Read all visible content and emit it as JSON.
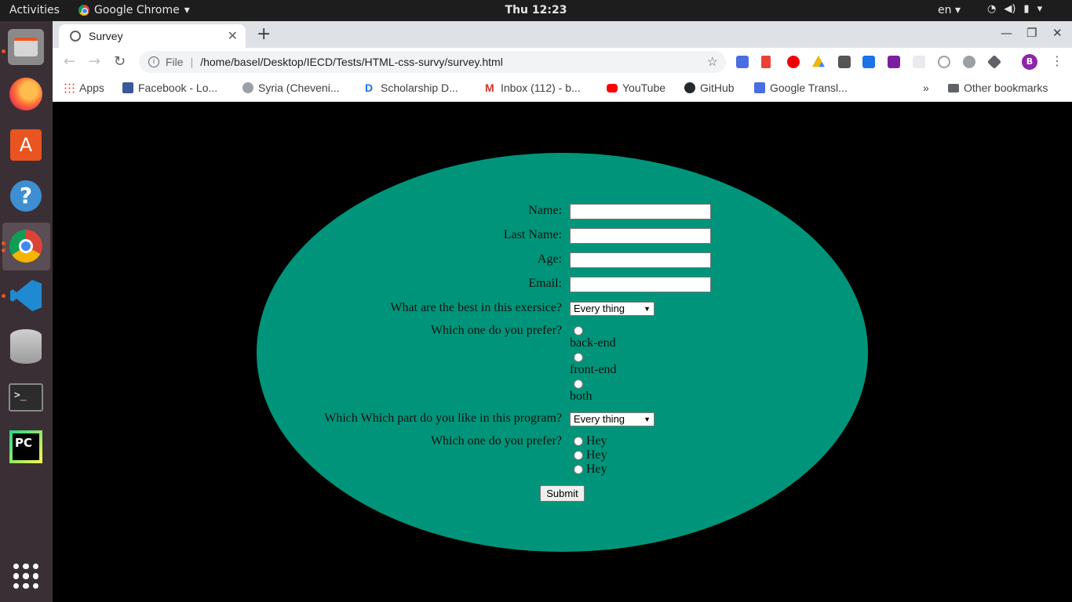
{
  "topbar": {
    "activities": "Activities",
    "app_name": "Google Chrome",
    "clock": "Thu 12:23",
    "lang": "en"
  },
  "tab": {
    "title": "Survey"
  },
  "omnibox": {
    "scheme_label": "File",
    "url": "/home/basel/Desktop/IECD/Tests/HTML-css-survy/survey.html"
  },
  "profile": {
    "initial": "B"
  },
  "bookmarks": {
    "items": [
      "Apps",
      "Facebook - Lo...",
      "Syria (Cheveni...",
      "Scholarship D...",
      "Inbox (112) - b...",
      "YouTube",
      "GitHub",
      "Google Transl..."
    ],
    "overflow": "»",
    "other": "Other bookmarks"
  },
  "form": {
    "name_label": "Name:",
    "lastname_label": "Last Name:",
    "age_label": "Age:",
    "email_label": "Email:",
    "q1_label": "What are the best in this exersice?",
    "q1_selected": "Every thing",
    "q2_label": "Which one do you prefer?",
    "q2_options": [
      "back-end",
      "front-end",
      "both"
    ],
    "q3_label": "Which Which part do you like in this program?",
    "q3_selected": "Every thing",
    "q4_label": "Which one do you prefer?",
    "q4_options": [
      "Hey",
      "Hey",
      "Hey"
    ],
    "submit_label": "Submit"
  },
  "colors": {
    "ellipse": "#00957a",
    "page_bg": "#000000",
    "dock_bg": "#3b2f36",
    "accent": "#e95420"
  }
}
